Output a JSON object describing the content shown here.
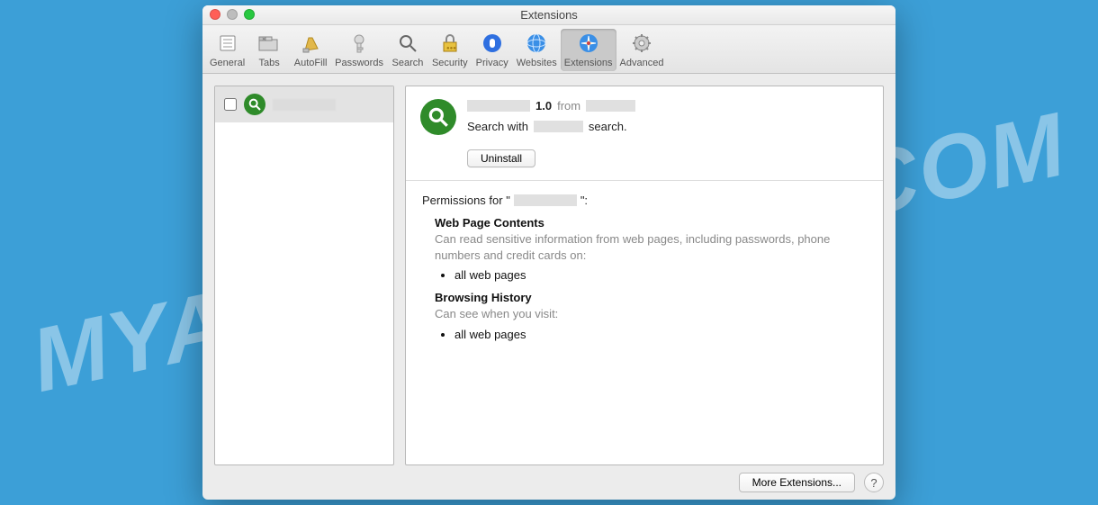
{
  "watermark": "MYANTISPYWARE.COM",
  "window": {
    "title": "Extensions",
    "toolbar": [
      {
        "key": "general",
        "label": "General"
      },
      {
        "key": "tabs",
        "label": "Tabs"
      },
      {
        "key": "autofill",
        "label": "AutoFill"
      },
      {
        "key": "passwords",
        "label": "Passwords"
      },
      {
        "key": "search",
        "label": "Search"
      },
      {
        "key": "security",
        "label": "Security"
      },
      {
        "key": "privacy",
        "label": "Privacy"
      },
      {
        "key": "websites",
        "label": "Websites"
      },
      {
        "key": "extensions",
        "label": "Extensions"
      },
      {
        "key": "advanced",
        "label": "Advanced"
      }
    ],
    "active_toolbar": "extensions"
  },
  "detail": {
    "version": "1.0",
    "from_label": "from",
    "desc_prefix": "Search with",
    "desc_suffix": "search.",
    "uninstall_label": "Uninstall",
    "permissions_prefix": "Permissions for \"",
    "permissions_suffix": "\":",
    "sections": {
      "contents": {
        "title": "Web Page Contents",
        "text": "Can read sensitive information from web pages, including passwords, phone numbers and credit cards on:",
        "item": "all web pages"
      },
      "history": {
        "title": "Browsing History",
        "text": "Can see when you visit:",
        "item": "all web pages"
      }
    }
  },
  "footer": {
    "more_label": "More Extensions...",
    "help_label": "?"
  }
}
